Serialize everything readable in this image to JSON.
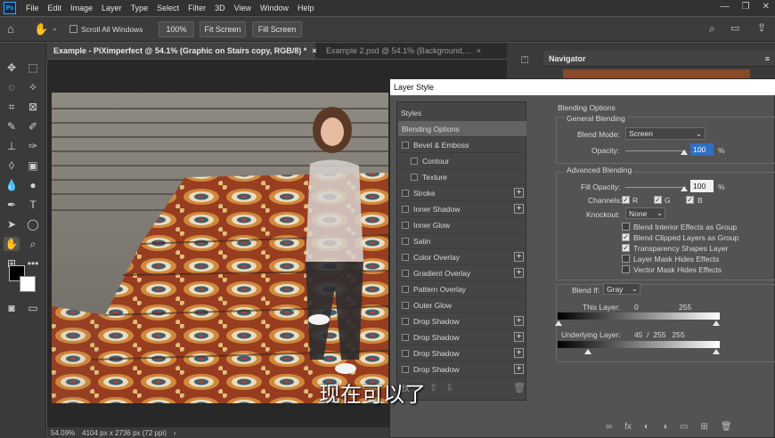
{
  "menu": {
    "logo": "Ps",
    "items": [
      "File",
      "Edit",
      "Image",
      "Layer",
      "Type",
      "Select",
      "Filter",
      "3D",
      "View",
      "Window",
      "Help"
    ]
  },
  "options": {
    "scroll_all": "Scroll All Windows",
    "zoom_value": "100%",
    "fit_screen": "Fit Screen",
    "fill_screen": "Fill Screen"
  },
  "tabs": [
    {
      "label": "Example - PiXimperfect @ 54.1% (Graphic on Stairs copy, RGB/8) *",
      "close": "×"
    },
    {
      "label": "Example 2.psd @ 54.1% (Background,...",
      "close": "×"
    }
  ],
  "status": {
    "zoom": "54.09%",
    "doc_size": "4104 px x 2736 px (72 ppi)",
    "arrow": "›"
  },
  "navigator": {
    "title": "Navigator"
  },
  "dialog": {
    "title": "Layer Style",
    "styles_header": "Styles",
    "list": [
      {
        "label": "Blending Options",
        "selected": true,
        "checkbox": false,
        "plus": false
      },
      {
        "label": "Bevel & Emboss",
        "checkbox": true,
        "plus": false
      },
      {
        "label": "Contour",
        "checkbox": true,
        "plus": false,
        "indent": true
      },
      {
        "label": "Texture",
        "checkbox": true,
        "plus": false,
        "indent": true
      },
      {
        "label": "Stroke",
        "checkbox": true,
        "plus": true
      },
      {
        "label": "Inner Shadow",
        "checkbox": true,
        "plus": true
      },
      {
        "label": "Inner Glow",
        "checkbox": true,
        "plus": false
      },
      {
        "label": "Satin",
        "checkbox": true,
        "plus": false
      },
      {
        "label": "Color Overlay",
        "checkbox": true,
        "plus": true
      },
      {
        "label": "Gradient Overlay",
        "checkbox": true,
        "plus": true
      },
      {
        "label": "Pattern Overlay",
        "checkbox": true,
        "plus": false
      },
      {
        "label": "Outer Glow",
        "checkbox": true,
        "plus": false
      },
      {
        "label": "Drop Shadow",
        "checkbox": true,
        "plus": true
      },
      {
        "label": "Drop Shadow",
        "checkbox": true,
        "plus": true
      },
      {
        "label": "Drop Shadow",
        "checkbox": true,
        "plus": true
      },
      {
        "label": "Drop Shadow",
        "checkbox": true,
        "plus": true
      }
    ],
    "blending_options": "Blending Options",
    "general_blending": "General Blending",
    "blend_mode_label": "Blend Mode:",
    "blend_mode_value": "Screen",
    "opacity_label": "Opacity:",
    "opacity_value": "100",
    "opacity_unit": "%",
    "advanced_blending": "Advanced Blending",
    "fill_opacity_label": "Fill Opacity:",
    "fill_opacity_value": "100",
    "fill_opacity_unit": "%",
    "channels_label": "Channels:",
    "channels": [
      {
        "label": "R",
        "checked": true
      },
      {
        "label": "G",
        "checked": true
      },
      {
        "label": "B",
        "checked": true
      }
    ],
    "knockout_label": "Knockout:",
    "knockout_value": "None",
    "checks": [
      {
        "label": "Blend Interior Effects as Group",
        "checked": false
      },
      {
        "label": "Blend Clipped Layers as Group",
        "checked": true
      },
      {
        "label": "Transparency Shapes Layer",
        "checked": true
      },
      {
        "label": "Layer Mask Hides Effects",
        "checked": false
      },
      {
        "label": "Vector Mask Hides Effects",
        "checked": false
      }
    ],
    "blend_if_label": "Blend If:",
    "blend_if_value": "Gray",
    "this_layer_label": "This Layer:",
    "this_layer_low": "0",
    "this_layer_high": "255",
    "underlying_label": "Underlying Layer:",
    "underlying_values": "45  /  255   255"
  },
  "subtitle": "现在可以了",
  "colors": {
    "accent": "#31a8ff",
    "panel": "#535353",
    "dark": "#323232"
  }
}
